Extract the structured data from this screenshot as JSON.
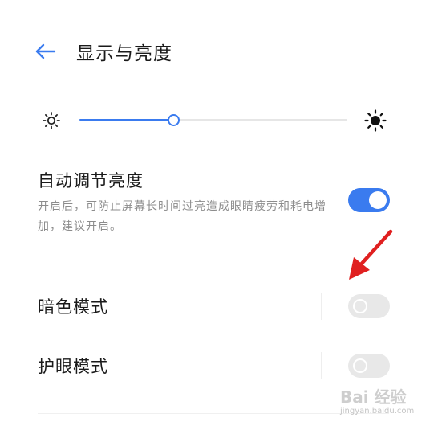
{
  "header": {
    "title": "显示与亮度",
    "back_icon": "back-arrow-icon"
  },
  "brightness": {
    "level": 0.35,
    "low_icon": "sun-small-icon",
    "high_icon": "sun-large-icon",
    "accent_color": "#3a7bef"
  },
  "auto_brightness": {
    "title": "自动调节亮度",
    "description": "开启后，可防止屏幕长时间过亮造成眼睛疲劳和耗电增加，建议开启。",
    "enabled": true
  },
  "dark_mode": {
    "label": "暗色模式",
    "enabled": false
  },
  "eye_care": {
    "label": "护眼模式",
    "enabled": false
  },
  "annotation": {
    "color": "#e02020",
    "icon": "red-arrow-icon"
  },
  "watermark": {
    "text": "Bai 经验",
    "sub": "jingyan.baidu.com"
  }
}
